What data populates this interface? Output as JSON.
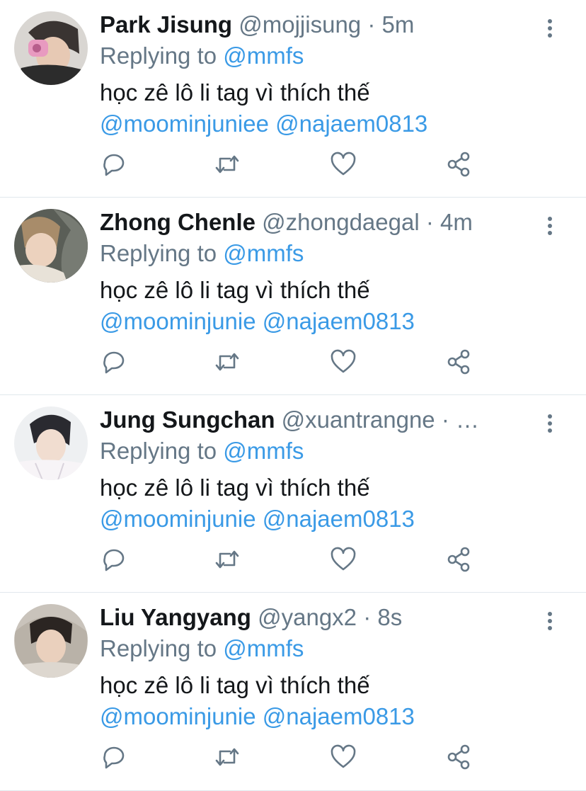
{
  "colors": {
    "link": "#3a9ae6",
    "muted": "#657786",
    "text": "#14171a",
    "divider": "#e1e8ed"
  },
  "icons": {
    "reply": "reply-icon",
    "retweet": "retweet-icon",
    "like": "like-icon",
    "share": "share-icon",
    "more": "more-vertical-icon"
  },
  "tweets": [
    {
      "name": "Park Jisung",
      "meta": "@mojjisung · 5m",
      "replying_prefix": "Replying to ",
      "replying_handle": "@mmfs",
      "text": "học zê lô li tag vì thích thế",
      "mention1": "@moominjuniee",
      "mention2": "@najaem0813"
    },
    {
      "name": "Zhong Chenle",
      "meta": "@zhongdaegal · 4m",
      "replying_prefix": "Replying to ",
      "replying_handle": "@mmfs",
      "text": "học zê lô li tag vì thích thế",
      "mention1": "@moominjunie",
      "mention2": "@najaem0813"
    },
    {
      "name": "Jung Sungchan",
      "meta": "@xuantrangne · …",
      "replying_prefix": "Replying to ",
      "replying_handle": "@mmfs",
      "text": "học zê lô li tag vì thích thế",
      "mention1": "@moominjunie",
      "mention2": "@najaem0813"
    },
    {
      "name": "Liu Yangyang",
      "meta": "@yangx2 · 8s",
      "replying_prefix": "Replying to ",
      "replying_handle": "@mmfs",
      "text": "học zê lô li tag vì thích thế",
      "mention1": "@moominjunie",
      "mention2": "@najaem0813"
    }
  ]
}
